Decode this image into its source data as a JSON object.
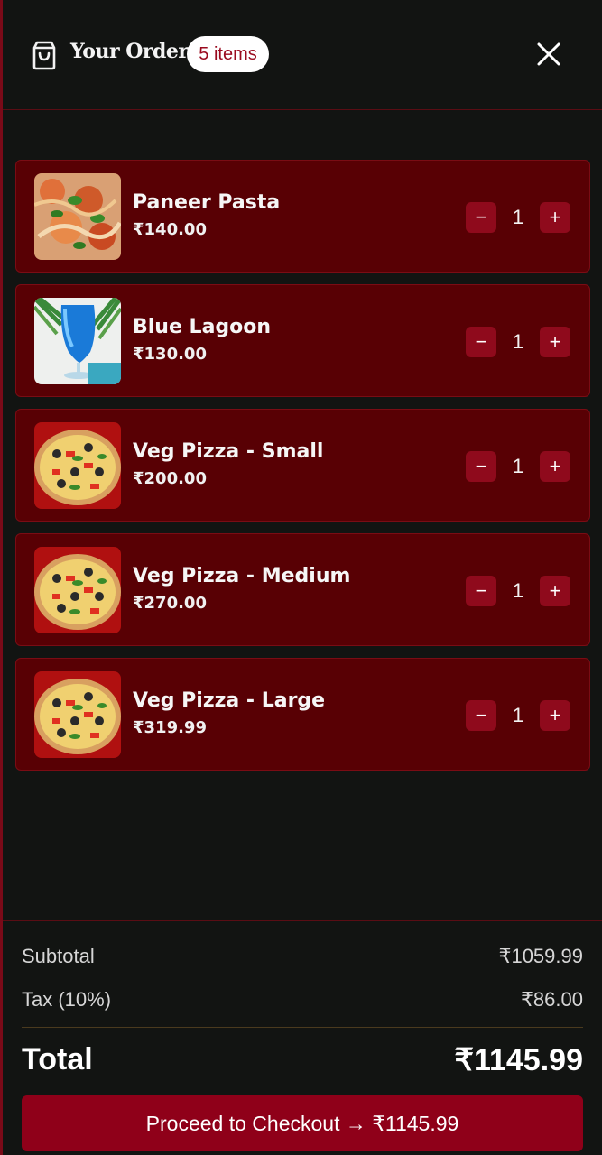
{
  "header": {
    "title": "Your Order",
    "count_badge": "5 items",
    "bag_icon": "shopping-bag-icon",
    "close_icon": "close-icon"
  },
  "items": [
    {
      "name": "Paneer Pasta",
      "price": "₹140.00",
      "qty": "1",
      "image": "pasta-thumbnail"
    },
    {
      "name": "Blue Lagoon",
      "price": "₹130.00",
      "qty": "1",
      "image": "drink-thumbnail"
    },
    {
      "name": "Veg Pizza - Small",
      "price": "₹200.00",
      "qty": "1",
      "image": "pizza-thumbnail"
    },
    {
      "name": "Veg Pizza - Medium",
      "price": "₹270.00",
      "qty": "1",
      "image": "pizza-thumbnail"
    },
    {
      "name": "Veg Pizza - Large",
      "price": "₹319.99",
      "qty": "1",
      "image": "pizza-thumbnail"
    }
  ],
  "qty_controls": {
    "minus": "−",
    "plus": "+"
  },
  "summary": {
    "subtotal_label": "Subtotal",
    "subtotal_value": "₹1059.99",
    "tax_label": "Tax (10%)",
    "tax_value": "₹86.00",
    "total_label": "Total",
    "total_value": "₹1145.99",
    "checkout_label": "Proceed to Checkout → ₹1145.99"
  },
  "colors": {
    "background": "#121412",
    "card": "#580004",
    "accent": "#8f0019",
    "badge_text": "#9a0a1e"
  }
}
